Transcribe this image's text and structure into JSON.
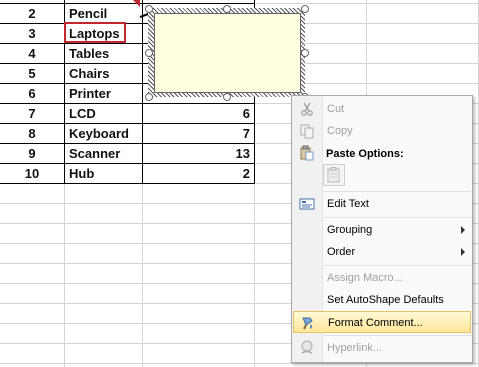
{
  "sheet": {
    "rows": [
      {
        "num": "2",
        "item": "Pencil",
        "value": ""
      },
      {
        "num": "3",
        "item": "Laptops",
        "value": ""
      },
      {
        "num": "4",
        "item": "Tables",
        "value": ""
      },
      {
        "num": "5",
        "item": "Chairs",
        "value": ""
      },
      {
        "num": "6",
        "item": "Printer",
        "value": ""
      },
      {
        "num": "7",
        "item": "LCD",
        "value": "6"
      },
      {
        "num": "8",
        "item": "Keyboard",
        "value": "7"
      },
      {
        "num": "9",
        "item": "Scanner",
        "value": "13"
      },
      {
        "num": "10",
        "item": "Hub",
        "value": "2"
      }
    ]
  },
  "context_menu": {
    "cut": "Cut",
    "copy": "Copy",
    "paste_options": "Paste Options:",
    "edit_text": "Edit Text",
    "grouping": "Grouping",
    "order": "Order",
    "assign_macro": "Assign Macro...",
    "set_autoshape_defaults": "Set AutoShape Defaults",
    "format_comment": "Format Comment...",
    "hyperlink": "Hyperlink..."
  },
  "colors": {
    "selection_border": "#c0282e",
    "comment_fill": "#ffffe1",
    "menu_hover": "#ffe79a"
  }
}
